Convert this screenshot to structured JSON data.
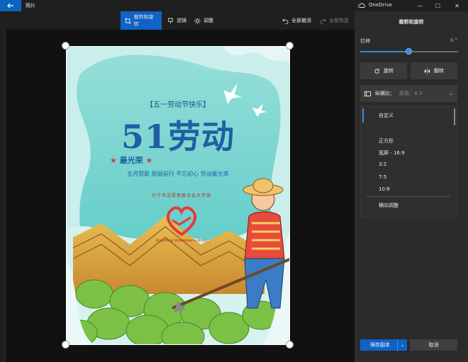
{
  "window": {
    "app_title": "照片",
    "onedrive_label": "OneDrive"
  },
  "toolbar": {
    "crop_rotate": "裁剪和旋转",
    "filters": "滤镜",
    "adjust": "调整",
    "undo_all": "全部撤消",
    "redo_all": "全部恢复"
  },
  "poster": {
    "headline_tag": "【五一劳动节快乐】",
    "big_number": "51劳动",
    "subtitle": "最光荣",
    "slogan": "五月赞歌 砥砺前行 不忘初心 劳动最光荣",
    "logo_arc_text": "兴宁市志愿者联合会大学部",
    "logo_bottom_text": "XingNing Volunteers Union"
  },
  "panel": {
    "title": "裁剪和旋转",
    "straighten_label": "拉伸",
    "straighten_value": "0 °",
    "straighten_fraction": 0.5,
    "rotate_label": "旋转",
    "flip_label": "翻转",
    "aspect_label": "纵横比：",
    "aspect_value": "原始：4:3",
    "aspect_options": [
      "自定义",
      "正方形",
      "宽屏 - 16:9",
      "3:2",
      "7:5",
      "10:8"
    ],
    "orientation_label": "横向调整",
    "save_copy": "保存副本",
    "cancel": "取消"
  },
  "colors": {
    "accent": "#0e63c5",
    "poster_teal": "#4fc6c2",
    "poster_blue": "#1f5fa5",
    "heart_red": "#e63b3b"
  }
}
